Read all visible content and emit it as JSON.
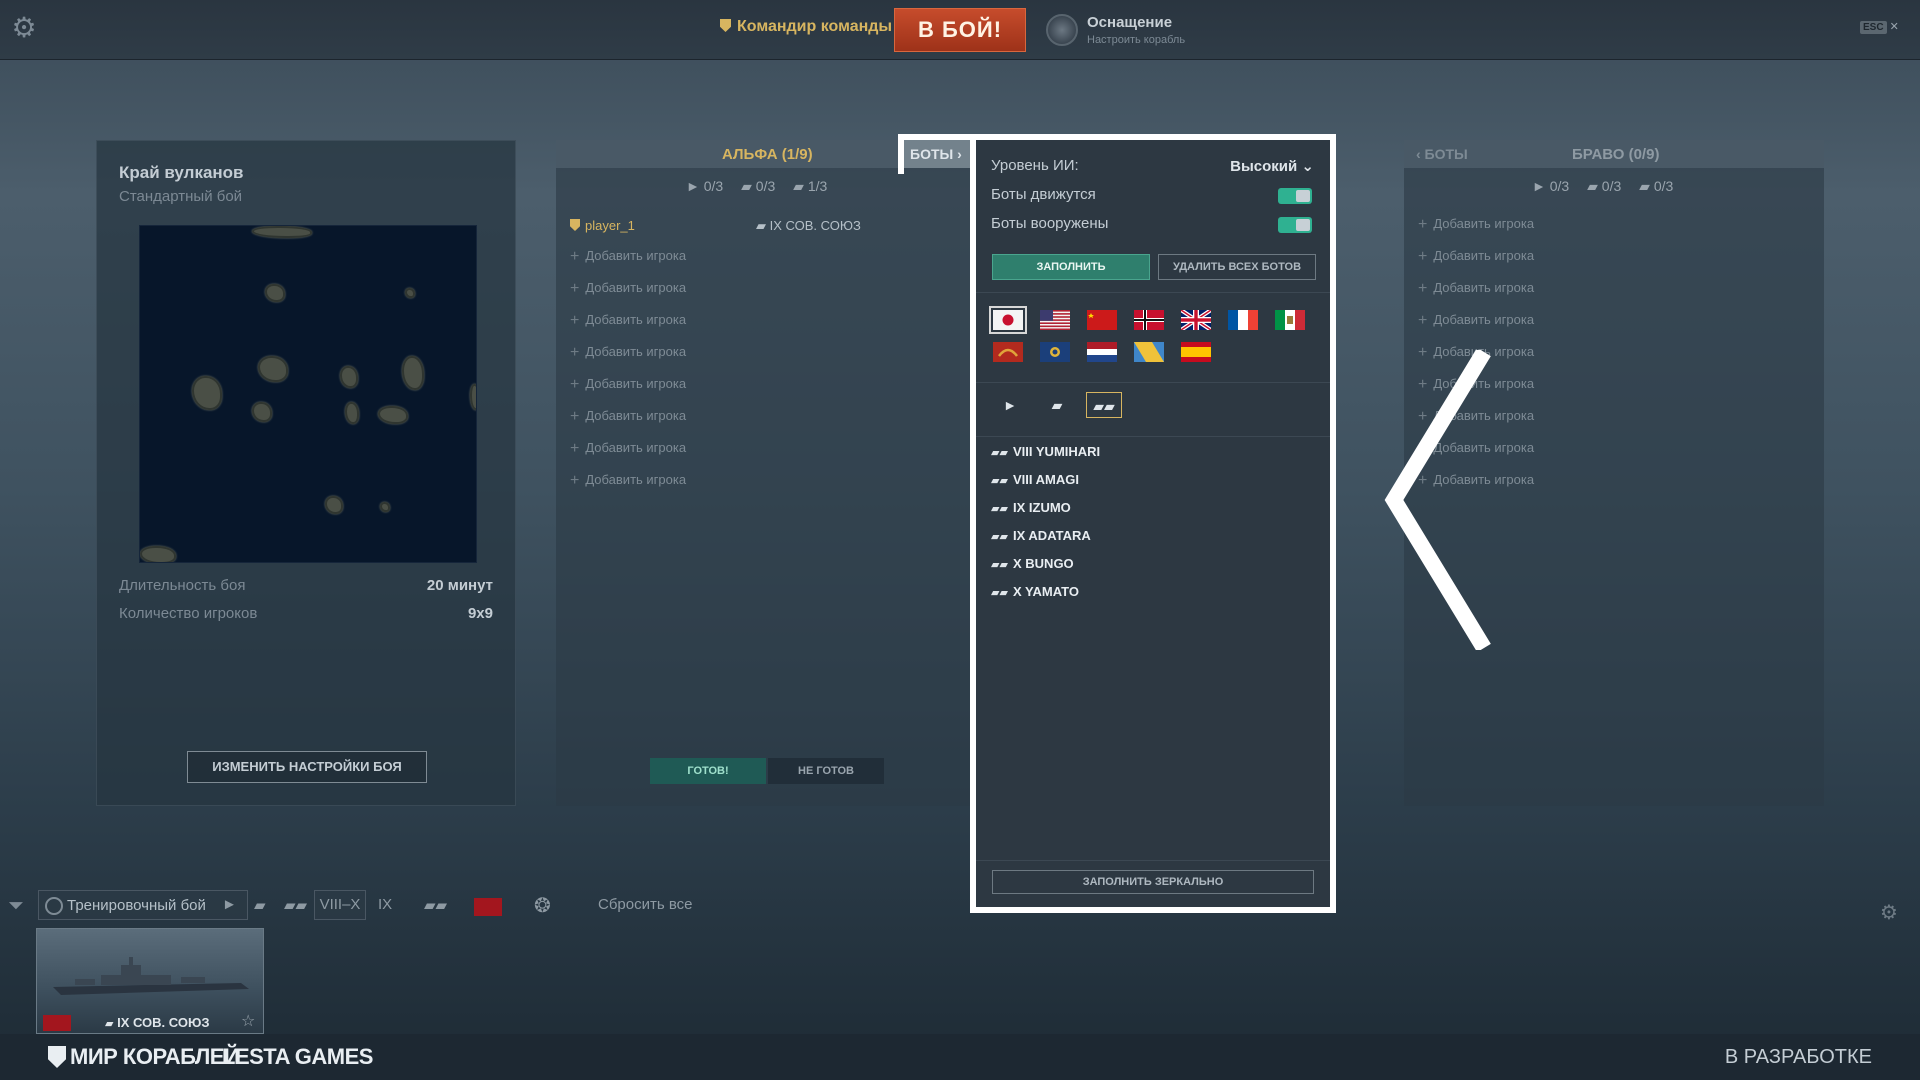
{
  "topbar": {
    "commander_label": "Командир команды",
    "battle_button": "В БОЙ!",
    "equipment_title": "Оснащение",
    "equipment_subtitle": "Настроить корабль",
    "esc_key": "ESC",
    "close_glyph": "✕"
  },
  "map_panel": {
    "map_name": "Край вулканов",
    "mode": "Стандартный бой",
    "duration_label": "Длительность боя",
    "duration_value": "20 минут",
    "players_label": "Количество игроков",
    "players_value": "9x9",
    "change_settings_button": "ИЗМЕНИТЬ НАСТРОЙКИ БОЯ"
  },
  "alpha": {
    "title": "АЛЬФА (1/9)",
    "count_bb": "0/3",
    "count_cr": "0/3",
    "count_dd": "1/3",
    "player_name": "player_1",
    "player_ship": "IX СОВ. СОЮЗ",
    "add_player": "Добавить игрока",
    "ready_button": "ГОТОВ!",
    "not_ready_button": "НЕ ГОТОВ"
  },
  "bravo": {
    "bots_link": "‹ БОТЫ",
    "title": "БРАВО (0/9)",
    "count_bb": "0/3",
    "count_cr": "0/3",
    "count_dd": "0/3",
    "add_player": "Добавить игрока"
  },
  "bots": {
    "tab_label": "БОТЫ ›",
    "ai_level_label": "Уровень ИИ:",
    "ai_level_value": "Высокий ⌄",
    "bots_move_label": "Боты движутся",
    "bots_armed_label": "Боты вооружены",
    "bots_move": true,
    "bots_armed": true,
    "fill_button": "ЗАПОЛНИТЬ",
    "remove_all_button": "УДАЛИТЬ ВСЕХ БОТОВ",
    "fill_mirror_button": "ЗАПОЛНИТЬ ЗЕРКАЛЬНО",
    "flags": [
      {
        "name": "japan-flag",
        "selected": true
      },
      {
        "name": "usa-flag"
      },
      {
        "name": "ussr-flag"
      },
      {
        "name": "germany-flag"
      },
      {
        "name": "uk-flag"
      },
      {
        "name": "france-flag"
      },
      {
        "name": "italy-flag"
      },
      {
        "name": "pan-asia-flag"
      },
      {
        "name": "commonwealth-flag"
      },
      {
        "name": "netherlands-flag"
      },
      {
        "name": "pan-america-flag"
      },
      {
        "name": "spain-flag"
      }
    ],
    "ships": [
      {
        "name": "VIII YUMIHARI"
      },
      {
        "name": "VIII AMAGI"
      },
      {
        "name": "IX IZUMO"
      },
      {
        "name": "IX ADATARA"
      },
      {
        "name": "X BUNGO"
      },
      {
        "name": "X YAMATO"
      }
    ]
  },
  "filters": {
    "mode": "Тренировочный бой",
    "tier_range": "VIII–X",
    "tier_single": "IX",
    "reset_all": "Сбросить все"
  },
  "carousel": {
    "ship_name": "IX СОВ. СОЮЗ"
  },
  "footer": {
    "logo_mir": "МИР КОРАБЛЕЙ",
    "logo_lesta": "LESTA GAMES",
    "dev_label": "В РАЗРАБОТКЕ"
  },
  "colors": {
    "accent_gold": "#d7b560",
    "battle_red": "#b33f22",
    "toggle_green": "#2fb191"
  }
}
